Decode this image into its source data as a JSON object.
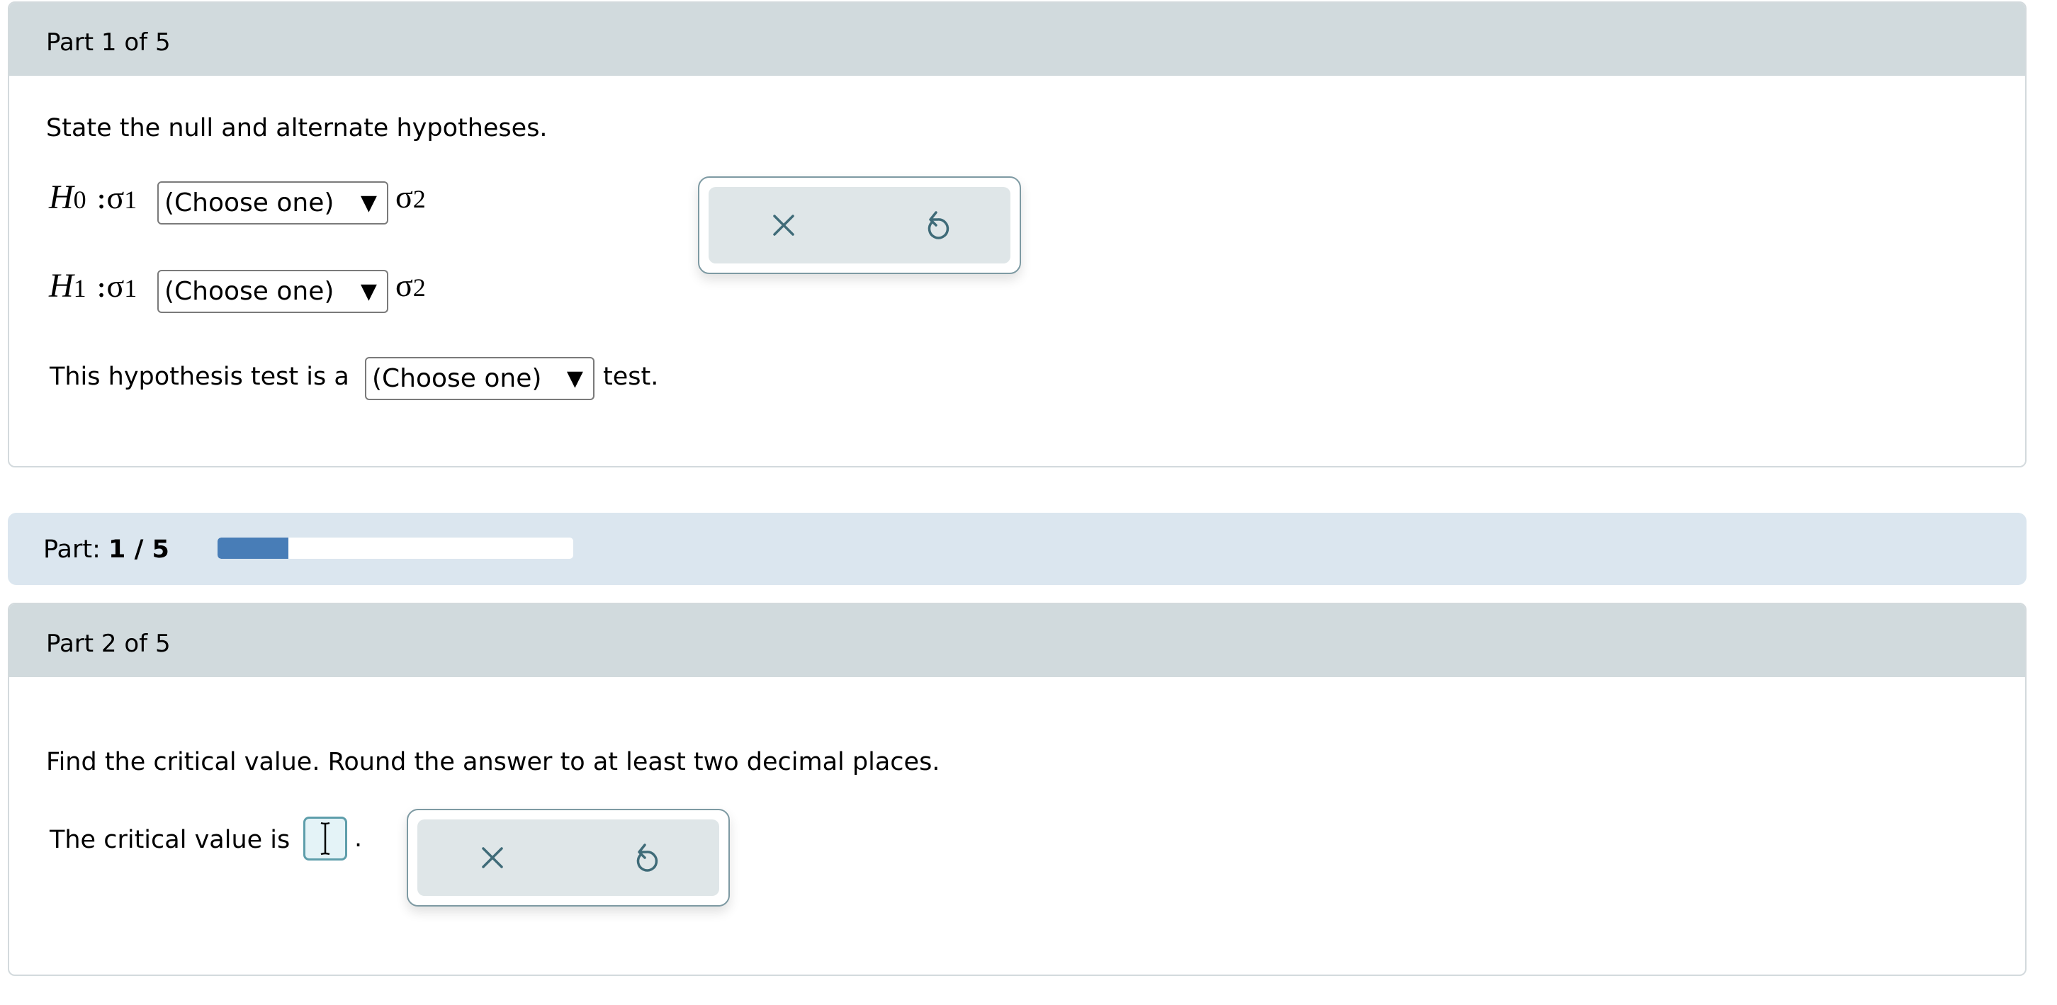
{
  "part1": {
    "header": "Part 1 of 5",
    "prompt": "State the null and alternate hypotheses.",
    "h0": {
      "symbol": "H",
      "subscript": "0",
      "colon": ":",
      "left_sigma": "σ",
      "left_sub": "1",
      "select_value": "(Choose one)",
      "right_sigma": "σ",
      "right_sub": "2"
    },
    "h1": {
      "symbol": "H",
      "subscript": "1",
      "colon": ":",
      "left_sigma": "σ",
      "left_sub": "1",
      "select_value": "(Choose one)",
      "right_sigma": "σ",
      "right_sub": "2"
    },
    "test_type": {
      "prefix": "This hypothesis test is a",
      "select_value": "(Choose one)",
      "suffix": "test."
    },
    "actions": {
      "clear_icon": "close-icon",
      "reset_icon": "undo-icon"
    }
  },
  "progress": {
    "label": "Part:",
    "current": "1 / 5",
    "fraction": 0.2,
    "fill_color": "#487db7"
  },
  "part2": {
    "header": "Part 2 of 5",
    "prompt": "Find the critical value. Round the answer to at least two decimal places.",
    "answer_prefix": "The critical value is",
    "answer_value": "",
    "answer_suffix": ".",
    "actions": {
      "clear_icon": "close-icon",
      "reset_icon": "undo-icon"
    }
  },
  "dropdown_arrow": "▼",
  "colors": {
    "header_bg": "#d1dadd",
    "progress_bg": "#dbe6ef",
    "icon_color": "#3f6b78",
    "action_bg": "#dfe6e8"
  }
}
